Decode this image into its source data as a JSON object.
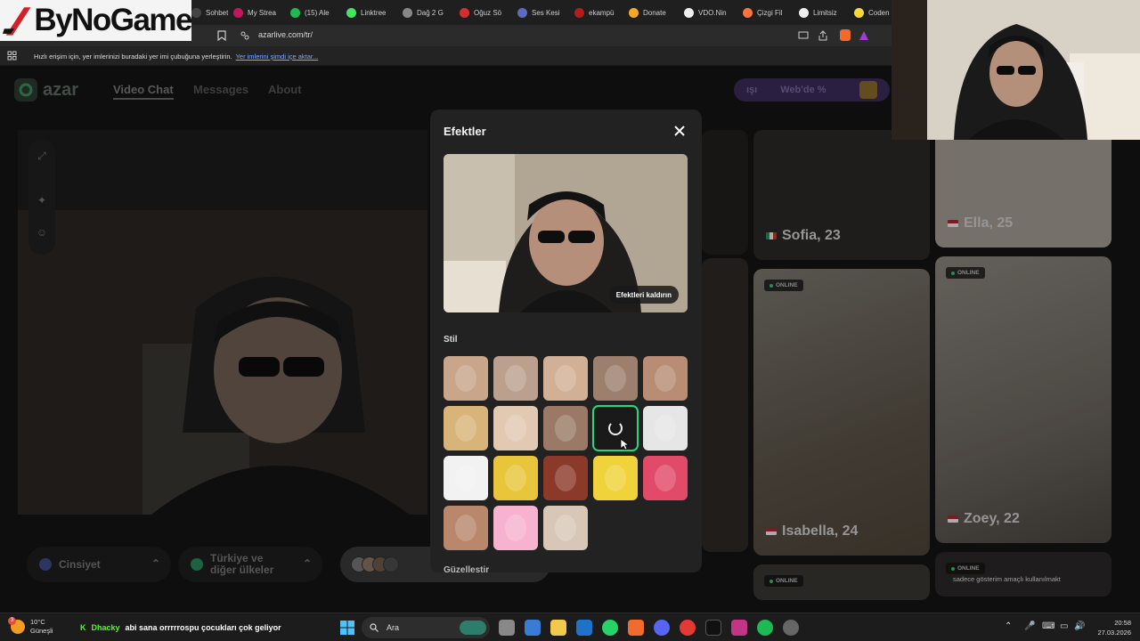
{
  "browser": {
    "tabs": [
      {
        "label": "Sohbet",
        "color": "#444444"
      },
      {
        "label": "My Strea",
        "color": "#c2185b"
      },
      {
        "label": "(15) Ale",
        "color": "#1db954"
      },
      {
        "label": "Linktree",
        "color": "#43e55e"
      },
      {
        "label": "Dağ 2 G",
        "color": "#888888"
      },
      {
        "label": "Oğuz Sö",
        "color": "#d32f2f"
      },
      {
        "label": "Ses Kesi",
        "color": "#5c6bc0"
      },
      {
        "label": "ekampü",
        "color": "#b71c1c"
      },
      {
        "label": "Donate",
        "color": "#f9a825"
      },
      {
        "label": "VDO.Nin",
        "color": "#eeeeee"
      },
      {
        "label": "Çizgi Fil",
        "color": "#ff7043"
      },
      {
        "label": "Limitsiz",
        "color": "#eeeeee"
      },
      {
        "label": "Coden",
        "color": "#fdd835"
      }
    ],
    "url": "azarlive.com/tr/",
    "bookmark_hint": "Hızlı erişim için, yer imlerinizi buradaki yer imi çubuğuna yerleştirin.",
    "bookmark_link": "Yer imlerini şimdi içe aktar..."
  },
  "overlay_logo": {
    "text": "ByNoGame"
  },
  "azar": {
    "brand": "azar",
    "nav": {
      "video_chat": "Video Chat",
      "messages": "Messages",
      "about": "About"
    },
    "promo": {
      "left": "ışı",
      "right": "Web'de %"
    },
    "filters": {
      "gender": "Cinsiyet",
      "region_line1": "Türkiye ve",
      "region_line2": "diğer ülkeler"
    },
    "cards": [
      {
        "name": "Sofia, 23",
        "flag": "it",
        "online": false
      },
      {
        "name": "Ella, 25",
        "flag": "us",
        "online": false
      },
      {
        "name": "Isabella, 24",
        "flag": "us",
        "online": true
      },
      {
        "name": "Zoey, 22",
        "flag": "us",
        "online": true
      }
    ],
    "online_label": "ONLINE",
    "bottom_caption": "sadece gösterim amaçlı kullanılmakt"
  },
  "modal": {
    "title": "Efektler",
    "remove_effects": "Efektleri kaldırın",
    "section_style": "Stil",
    "section_next": "Güzelleştir",
    "effects": [
      "face-swap-1",
      "face-swap-2",
      "face-swap-3",
      "face-swap-4",
      "face-swap-5",
      "mask-white",
      "glasses-woman",
      "cat-face",
      "dark-bunny-loading",
      "cartoon-monster",
      "cartoon-face",
      "flip-flop",
      "leopard-woman",
      "yellow-mask",
      "heart-face",
      "smile-woman",
      "bunny-ears",
      "sunglasses-woman"
    ],
    "selected_effect": "dark-bunny-loading"
  },
  "taskbar": {
    "weather_temp": "10°C",
    "weather_desc": "Güneşli",
    "weather_badge": "3",
    "chat_user": "Dhacky",
    "chat_message": "abi sana orrrrrospu çocukları çok geliyor",
    "search_placeholder": "Ara",
    "time": "20:58",
    "date": "27.03.2026"
  },
  "colors": {
    "accent_green": "#2ad67a",
    "kick_green": "#53fc18",
    "modal_bg": "#222222"
  }
}
